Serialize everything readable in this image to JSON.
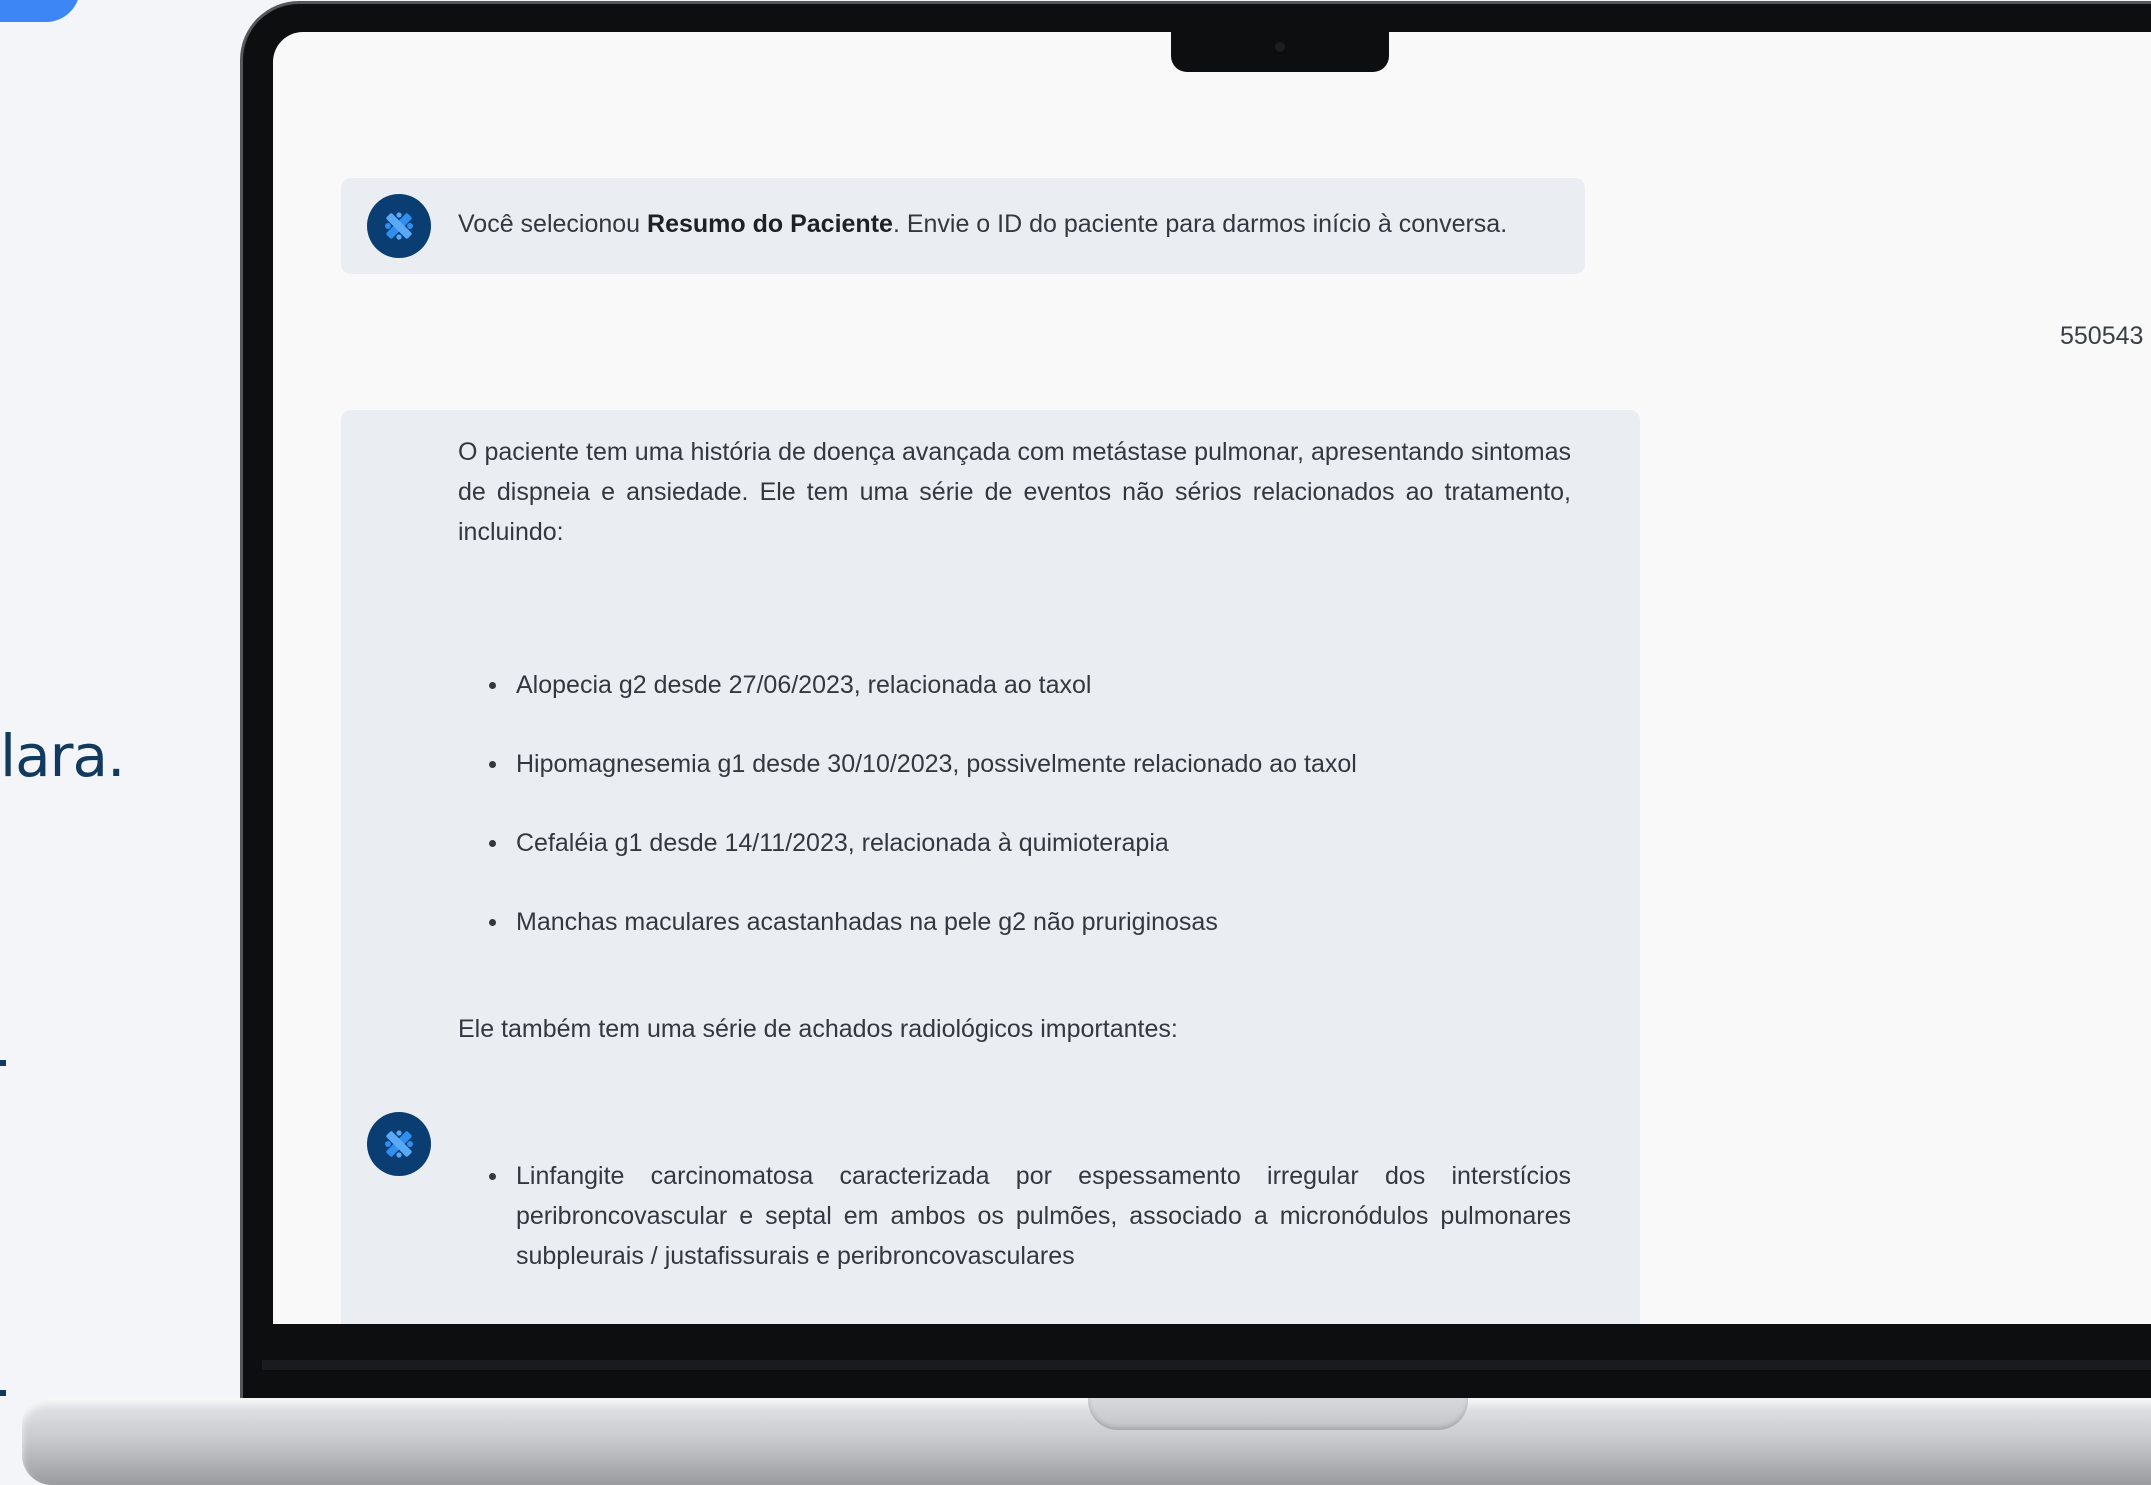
{
  "background": {
    "fragment_text": "lara.",
    "accent_color": "#3d86f5",
    "text_color": "#123a5e"
  },
  "chat": {
    "message1": {
      "prefix": "Você selecionou ",
      "bold": "Resumo do Paciente",
      "suffix": ". Envie o ID do paciente para darmos início à conversa."
    },
    "user_message": "550543",
    "message2": {
      "intro": "O paciente tem uma história de doença avançada com metástase pulmonar, apresentando sintomas de dispneia e ansiedade. Ele tem uma série de eventos não sérios relacionados ao tratamento, incluindo:",
      "events": [
        "Alopecia g2 desde 27/06/2023, relacionada ao taxol",
        "Hipomagnesemia g1 desde 30/10/2023, possivelmente relacionado ao taxol",
        "Cefaléia g1 desde 14/11/2023, relacionada à quimioterapia",
        "Manchas maculares acastanhadas na pele g2 não pruriginosas"
      ],
      "radiology_intro": "Ele também tem uma série de achados radiológicos importantes:",
      "findings": [
        "Linfangite carcinomatosa caracterizada por espessamento irregular dos interstícios peribroncovascular e septal em ambos os pulmões, associado a micronódulos pulmonares subpleurais / justafissurais e peribroncovasculares"
      ]
    },
    "assistant_icon": "assistant-logo-icon",
    "bubble_color": "#eaeef2",
    "avatar_color": "#0a3d71"
  }
}
